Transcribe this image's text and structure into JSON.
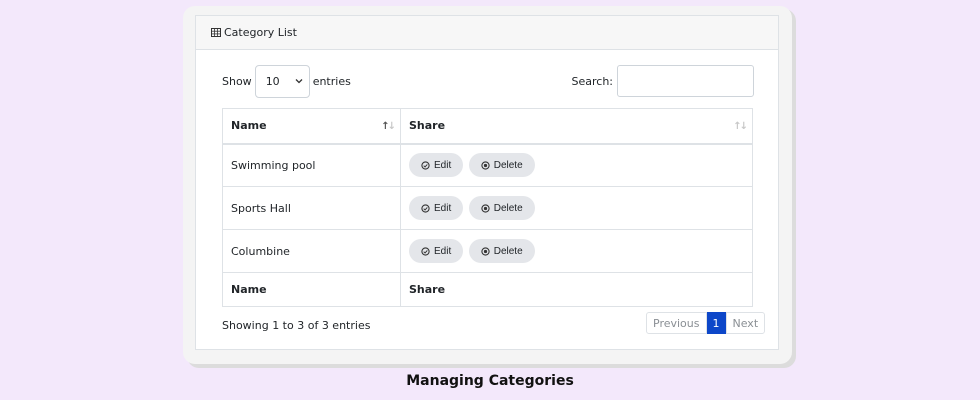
{
  "panel": {
    "title": "Category List",
    "title_icon": "table-icon"
  },
  "controls": {
    "show_label": "Show",
    "page_size": "10",
    "entries_label": "entries",
    "search_label": "Search:",
    "search_value": ""
  },
  "table": {
    "headers": [
      "Name",
      "Share"
    ],
    "rows": [
      {
        "name": "Swimming pool",
        "edit_label": "Edit",
        "delete_label": "Delete"
      },
      {
        "name": "Sports Hall",
        "edit_label": "Edit",
        "delete_label": "Delete"
      },
      {
        "name": "Columbine",
        "edit_label": "Edit",
        "delete_label": "Delete"
      }
    ],
    "footers": [
      "Name",
      "Share"
    ]
  },
  "footer": {
    "info": "Showing 1 to 3 of 3 entries",
    "previous": "Previous",
    "current_page": "1",
    "next": "Next"
  },
  "caption": "Managing Categories",
  "colors": {
    "background": "#f3e8fb",
    "active_page": "#0d47c9",
    "button_bg": "#e4e6ea"
  }
}
